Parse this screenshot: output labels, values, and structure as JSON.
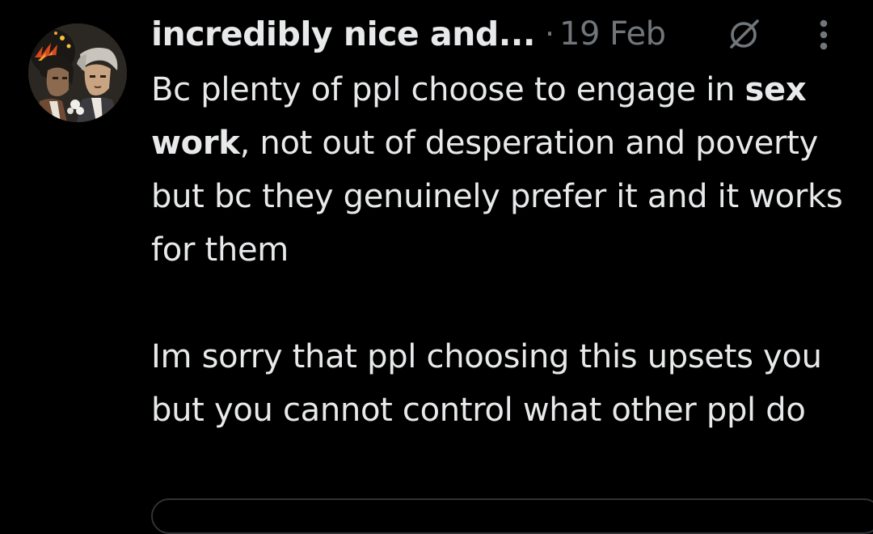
{
  "tweet": {
    "display_name": "incredibly nice and...",
    "separator": "·",
    "date": "19 Feb",
    "text": {
      "paragraph1_before": "Bc plenty of ppl choose to engage in ",
      "paragraph1_bold": "sex work",
      "paragraph1_after": ", not out of desperation and poverty but bc they genuinely prefer it and it works for them",
      "paragraph2": "Im sorry that ppl choosing this upsets you but you cannot control what other ppl do"
    }
  },
  "icons": {
    "avatar": "profile-avatar",
    "muted": "muted-conversation-icon",
    "more": "more-options-icon"
  },
  "colors": {
    "background": "#000000",
    "primary_text": "#e7e9ea",
    "secondary_text": "#71767b",
    "border": "#2f3336"
  }
}
